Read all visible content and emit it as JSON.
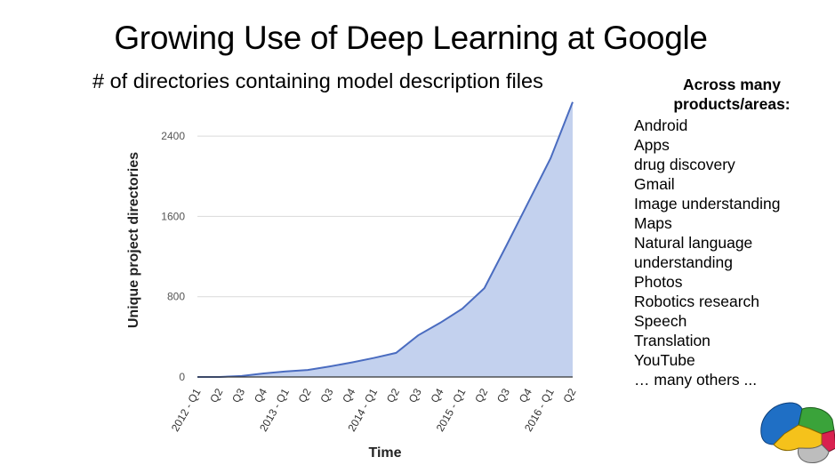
{
  "title": "Growing Use of Deep Learning at Google",
  "subtitle": "# of directories containing model description files",
  "side_panel": {
    "heading": "Across many products/areas:",
    "items": [
      "Android",
      "Apps",
      "drug discovery",
      "Gmail",
      "Image understanding",
      "Maps",
      "Natural language",
      "understanding",
      "Photos",
      "Robotics research",
      "Speech",
      "Translation",
      "YouTube",
      "… many others ..."
    ]
  },
  "logo": {
    "icon": "brain-icon",
    "colors": [
      "#1f6fc5",
      "#3aa33a",
      "#f5c21b",
      "#d9214f",
      "#bdbdbd"
    ]
  },
  "chart_data": {
    "type": "area",
    "title": "# of directories containing model description files",
    "xlabel": "Time",
    "ylabel": "Unique project directories",
    "categories": [
      "2012 - Q1",
      "Q2",
      "Q3",
      "Q4",
      "2013 - Q1",
      "Q2",
      "Q3",
      "Q4",
      "2014 - Q1",
      "Q2",
      "Q3",
      "Q4",
      "2015 - Q1",
      "Q2",
      "Q3",
      "Q4",
      "2016 - Q1",
      "Q2"
    ],
    "series": [
      {
        "name": "Unique project directories",
        "values": [
          0,
          0,
          10,
          35,
          55,
          70,
          105,
          145,
          190,
          240,
          415,
          540,
          680,
          885,
          1310,
          1745,
          2180,
          2740
        ]
      }
    ],
    "yticks": [
      0,
      800,
      1600,
      2400
    ],
    "ylim": [
      0,
      2750
    ],
    "grid": true,
    "legend": "none",
    "colors": {
      "line": "#4a6cc0",
      "fill": "#c3d1ee",
      "grid": "#d9d9d9",
      "baseline": "#333333"
    }
  }
}
